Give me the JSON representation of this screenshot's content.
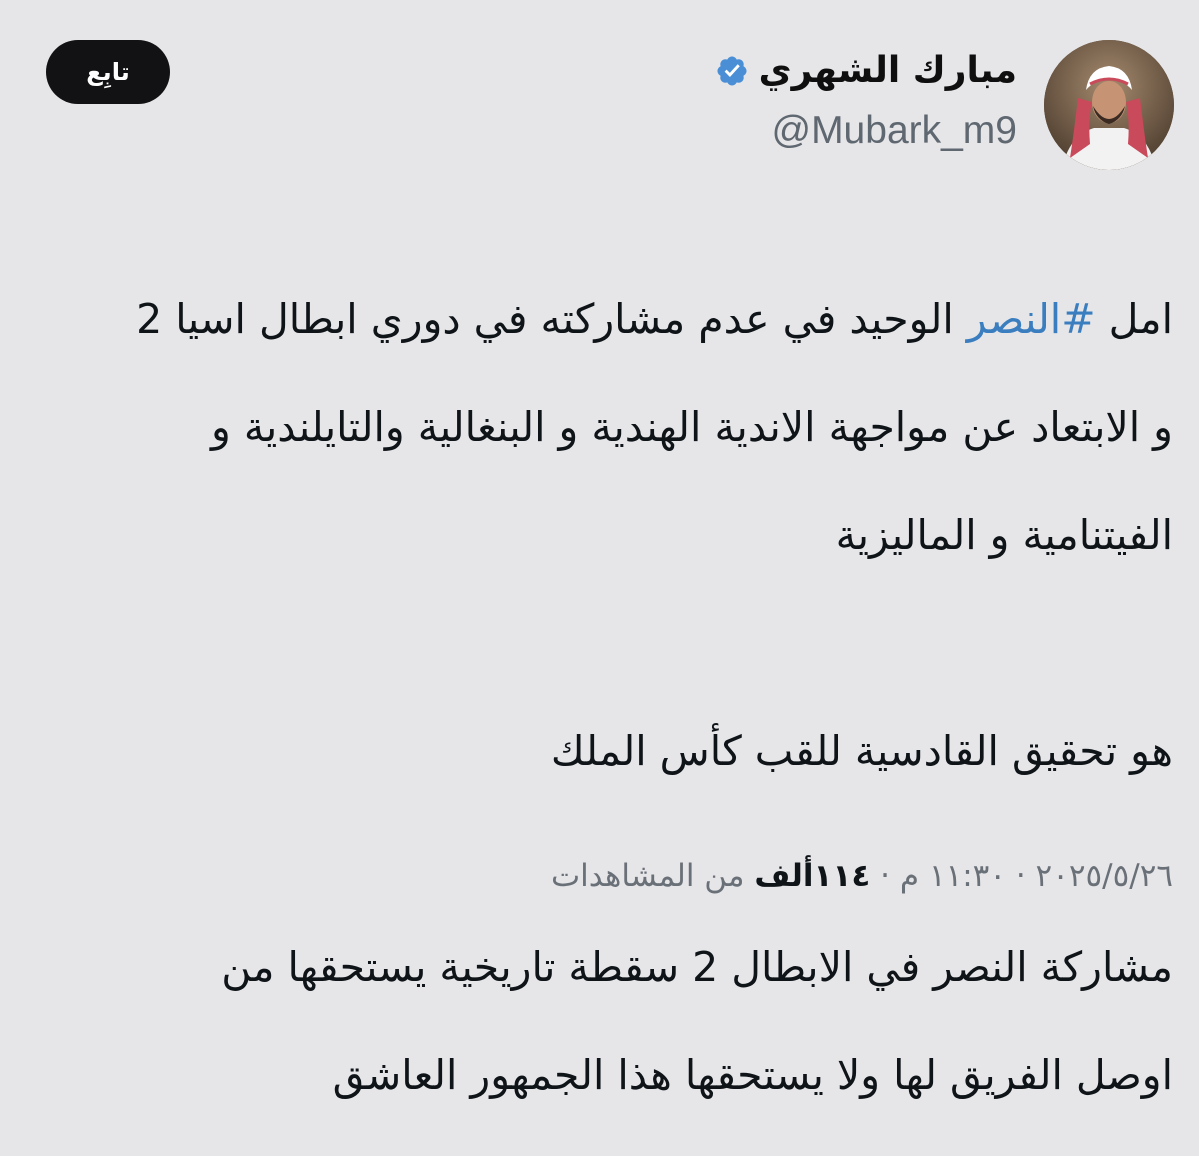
{
  "follow_button": {
    "label": "تابِع"
  },
  "user": {
    "display_name": "مبارك الشهري",
    "handle": "@Mubark_m9"
  },
  "tweet": {
    "lines": [
      {
        "prefix": "امل ",
        "hashtag": "#النصر",
        "suffix": " الوحيد في عدم مشاركته في دوري ابطال اسيا 2"
      },
      {
        "text": "و الابتعاد عن مواجهة الاندية الهندية و البنغالية والتايلندية و"
      },
      {
        "text": "الفيتنامية و  الماليزية"
      },
      {
        "text": "هو تحقيق القادسية للقب كأس الملك"
      },
      {
        "text": "مشاركة النصر في الابطال 2  سقطة تاريخية يستحقها من"
      },
      {
        "text": "اوصل الفريق لها  ولا يستحقها هذا الجمهور العاشق"
      }
    ]
  },
  "meta": {
    "date": "٢٠٢٥/٥/٢٦",
    "separator": " · ",
    "time": "١١:٣٠ م",
    "views_count": "١١٤ألف",
    "views_label": " من المشاهدات"
  },
  "colors": {
    "background": "#e6e6e8",
    "hashtag": "#3a7ec0",
    "verified": "#4a8fd6",
    "follow_button": "#121214"
  },
  "icons": {
    "verified": "verified-badge-icon"
  }
}
